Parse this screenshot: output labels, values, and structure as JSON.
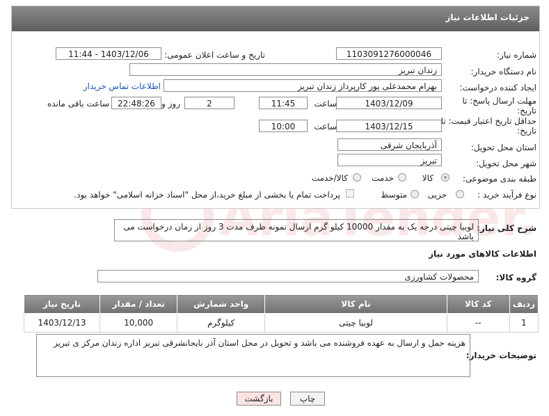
{
  "panel": {
    "title": "جزئیات اطلاعات نیاز"
  },
  "fields": {
    "need_number_label": "شماره نیاز:",
    "need_number": "1103091276000046",
    "announce_label": "تاریخ و ساعت اعلان عمومی:",
    "announce_value": "1403/12/06 - 11:44",
    "buyer_org_label": "نام دستگاه خریدار:",
    "buyer_org": "زندان تبریز",
    "creator_label": "ایجاد کننده درخواست:",
    "creator": "بهرام محمدعلی پور کارپرداز زندان تبریز",
    "contact_link": "اطلاعات تماس خریدار",
    "reply_deadline_label_1": "مهلت ارسال پاسخ: تا",
    "reply_deadline_label_2": "تاریخ:",
    "reply_date": "1403/12/09",
    "time_label": "ساعت",
    "reply_time": "11:45",
    "days_value": "2",
    "days_label": "روز و",
    "remaining_time": "22:48:26",
    "remaining_label": "ساعت باقی مانده",
    "price_valid_label_1": "حداقل تاریخ اعتبار قیمت: تا",
    "price_valid_label_2": "تاریخ:",
    "price_date": "1403/12/15",
    "price_time": "10:00",
    "province_label": "استان محل تحویل:",
    "province": "آذربایجان شرقی",
    "city_label": "شهر محل تحویل:",
    "city": "تبریز",
    "category_label": "طبقه بندی موضوعی:",
    "category_options": [
      "کالا",
      "خدمت",
      "کالا/خدمت"
    ],
    "category_selected": "کالا",
    "process_label": "نوع فرآیند خرید :",
    "process_options": [
      "جزیی",
      "متوسط"
    ],
    "payment_note": "پرداخت تمام یا بخشی از مبلغ خرید،از محل \"اسناد خزانه اسلامی\" خواهد بود."
  },
  "description": {
    "label": "شرح کلی نیاز:",
    "text": "لوبیا چیتی درجه یک  به مقدار 10000 کیلو گرم ارسال نمونه ظرف مدت 3 روز از زمان درخواست می باشد"
  },
  "goods_section": {
    "title": "اطلاعات کالاهای مورد نیاز",
    "group_label": "گروه کالا:",
    "group_value": "محصولات کشاورزی"
  },
  "table": {
    "headers": [
      "ردیف",
      "کد کالا",
      "نام کالا",
      "واحد شمارش",
      "تعداد / مقدار",
      "تاریخ نیاز"
    ],
    "rows": [
      [
        "1",
        "--",
        "لوبیا چیتی",
        "کیلوگرم",
        "10,000",
        "1403/12/13"
      ]
    ]
  },
  "buyer_notes": {
    "label": "توضیحات خریدار:",
    "text": "هزینه حمل و ارسال به عهده فروشنده می باشد و تحویل در محل استان آذر بایجانشرقی تبریز اداره زندان مرکز ی تبریز"
  },
  "buttons": {
    "back": "بازگشت",
    "print": "چاپ"
  },
  "watermark": {
    "text": "AriaTender.neT"
  }
}
